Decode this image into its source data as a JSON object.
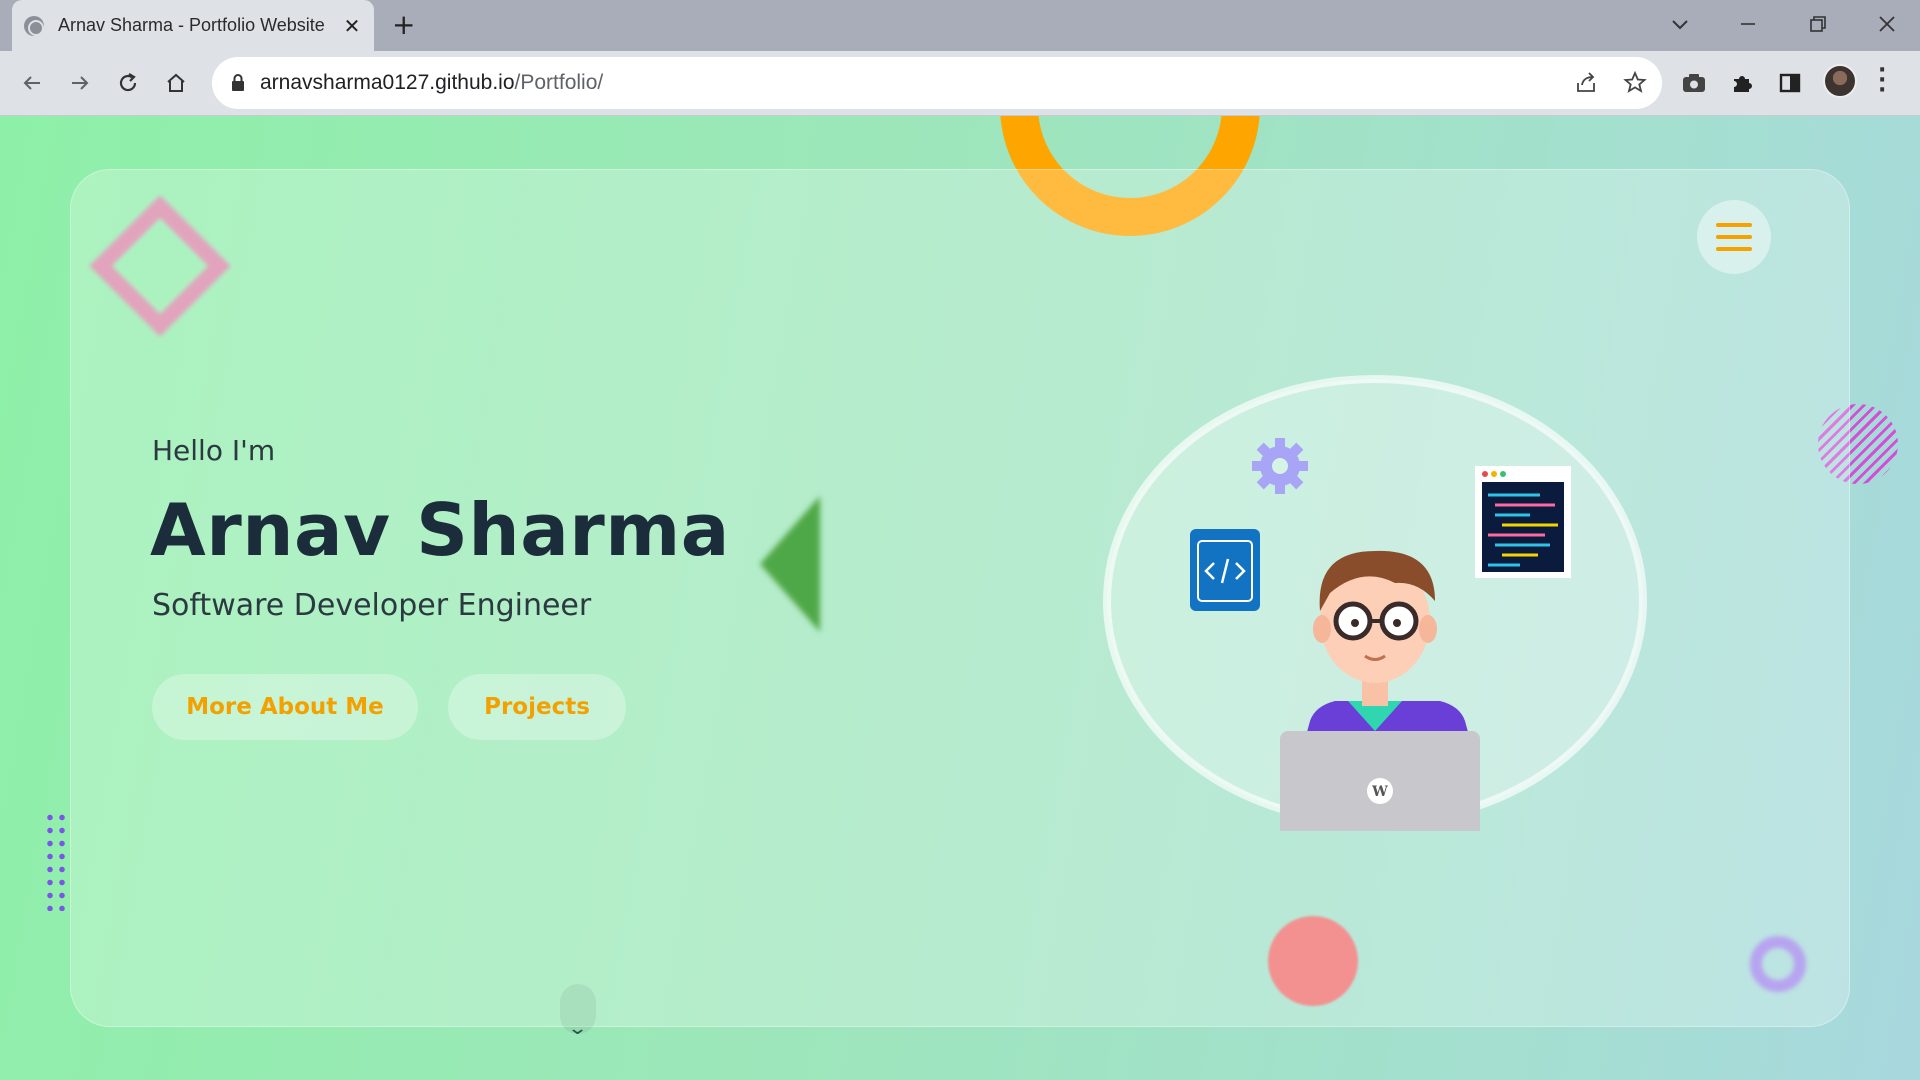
{
  "browser": {
    "tab_title": "Arnav Sharma - Portfolio Website",
    "tab_close": "✕",
    "new_tab": "+",
    "url_host": "arnavsharma0127.github.io",
    "url_path": "/Portfolio/"
  },
  "hero": {
    "greeting": "Hello I'm",
    "name": "Arnav Sharma",
    "role": "Software Developer Engineer",
    "buttons": {
      "about": "More About Me",
      "projects": "Projects"
    }
  },
  "colors": {
    "accent": "#f2a100",
    "name_text": "#1b2c3a",
    "background_start": "#8ef0a8",
    "background_end": "#a8d8de"
  },
  "icons": [
    "globe-icon",
    "close-icon",
    "plus-icon",
    "chevron-down-icon",
    "minimize-icon",
    "restore-icon",
    "window-close-icon",
    "back-arrow-icon",
    "forward-arrow-icon",
    "reload-icon",
    "home-icon",
    "lock-icon",
    "share-icon",
    "star-icon",
    "camera-extension-icon",
    "puzzle-icon",
    "side-panel-icon",
    "avatar",
    "more-vert-icon",
    "hamburger-menu-icon",
    "scroll-down-icon"
  ]
}
